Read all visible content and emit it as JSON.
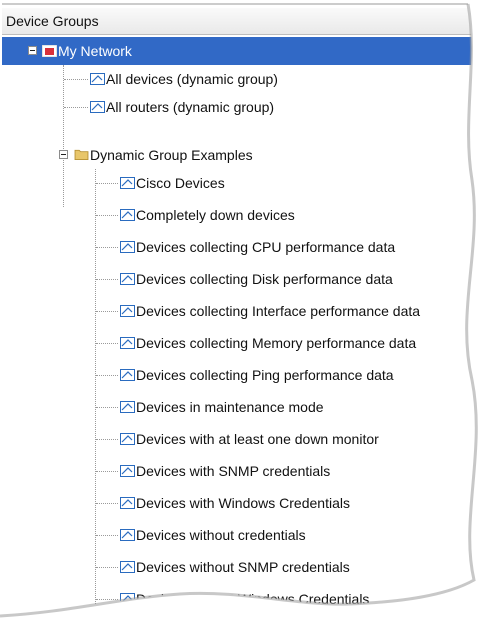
{
  "panel": {
    "title": "Device Groups"
  },
  "root": {
    "label": "My Network"
  },
  "top_groups": [
    {
      "label": "All devices (dynamic group)"
    },
    {
      "label": "All routers (dynamic group)"
    }
  ],
  "folder": {
    "label": "Dynamic Group Examples"
  },
  "children": [
    {
      "label": "Cisco Devices"
    },
    {
      "label": "Completely down devices"
    },
    {
      "label": "Devices collecting CPU performance data"
    },
    {
      "label": "Devices collecting Disk performance data"
    },
    {
      "label": "Devices collecting Interface performance data"
    },
    {
      "label": "Devices collecting Memory performance data"
    },
    {
      "label": "Devices collecting Ping performance data"
    },
    {
      "label": "Devices in maintenance mode"
    },
    {
      "label": "Devices with at least one down monitor"
    },
    {
      "label": "Devices with SNMP credentials"
    },
    {
      "label": "Devices with Windows Credentials"
    },
    {
      "label": "Devices without credentials"
    },
    {
      "label": "Devices without SNMP credentials"
    },
    {
      "label": "Devices without Windows Credentials"
    }
  ],
  "colors": {
    "selection": "#3169c6",
    "root_icon": "#d9303a",
    "folder": "#e8c66a",
    "doc_frame": "#2a6bbf"
  }
}
